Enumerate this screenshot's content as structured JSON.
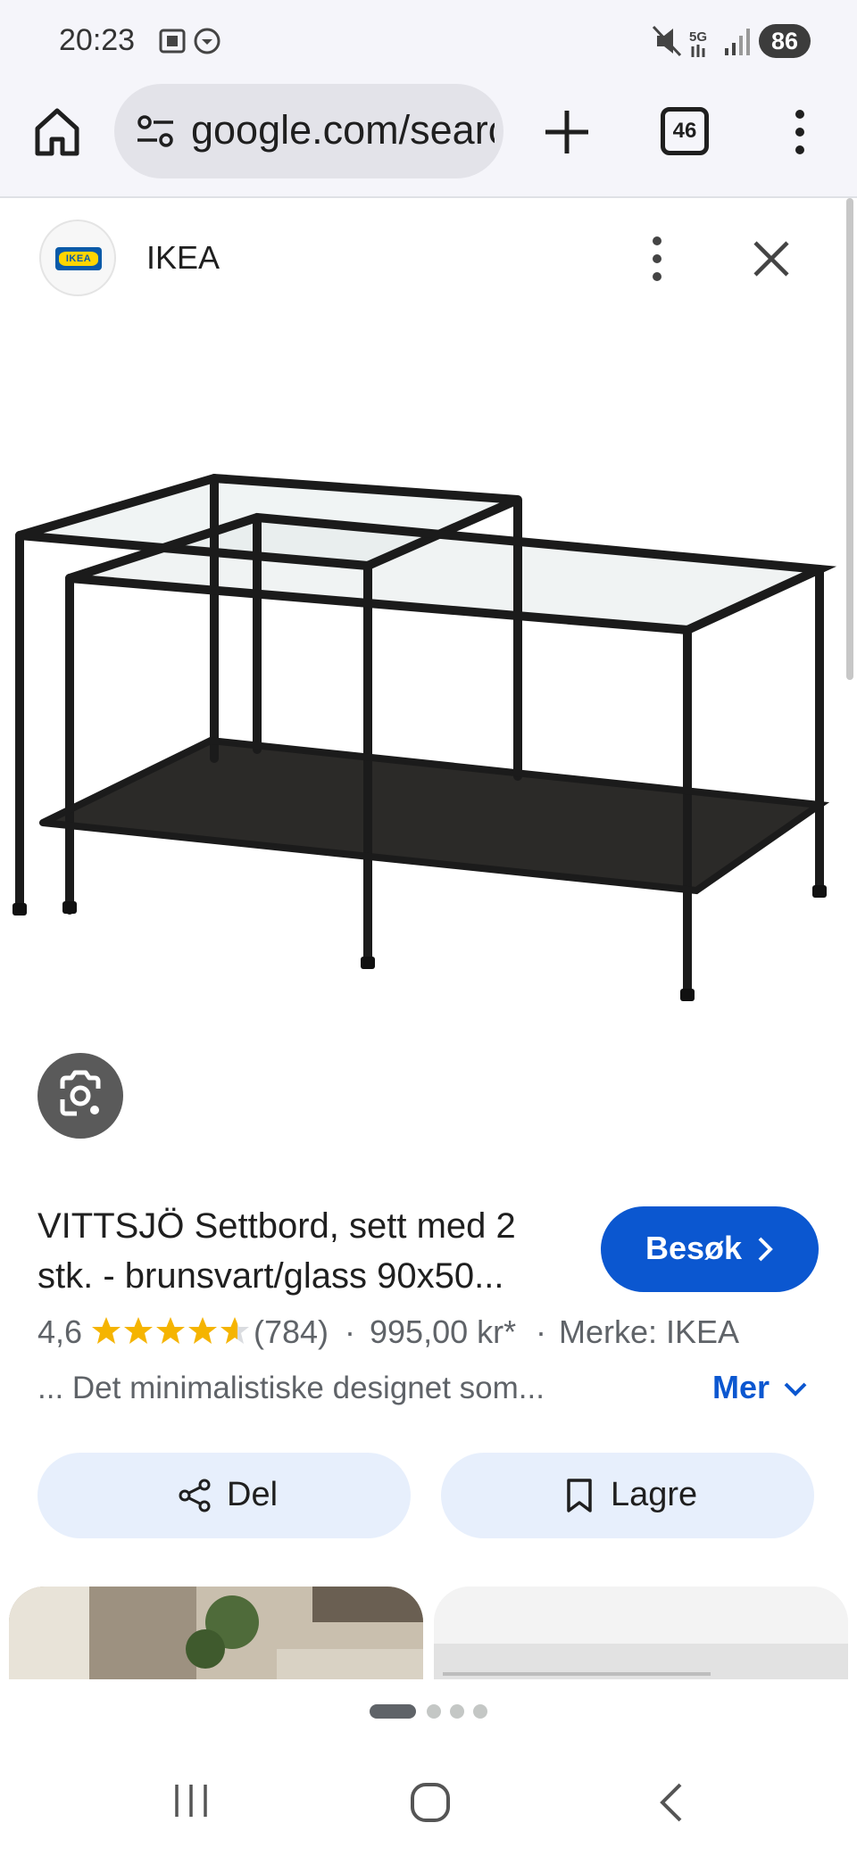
{
  "status_bar": {
    "time": "20:23",
    "network": "5G",
    "battery": "86"
  },
  "browser": {
    "url": "google.com/search",
    "tab_count": "46"
  },
  "source": {
    "name": "IKEA",
    "logo_text": "IKEA"
  },
  "product": {
    "title_line1": "VITTSJÖ Settbord, sett med 2",
    "title_line2": "stk. - brunsvart/glass 90x50...",
    "rating": "4,6",
    "stars": 4.6,
    "review_count": "(784)",
    "separator": "·",
    "price": "995,00 kr*",
    "brand": "Merke: IKEA",
    "description": "... Det minimalistiske designet som...",
    "visit_label": "Besøk",
    "more_label": "Mer"
  },
  "actions": {
    "share_label": "Del",
    "save_label": "Lagre"
  },
  "carousel": {
    "active_index": 0,
    "dot_count": 4
  },
  "colors": {
    "accent": "#0b57d0",
    "star": "#f5b400",
    "chip_bg": "#e7effc",
    "browser_bg": "#f5f5fa"
  }
}
